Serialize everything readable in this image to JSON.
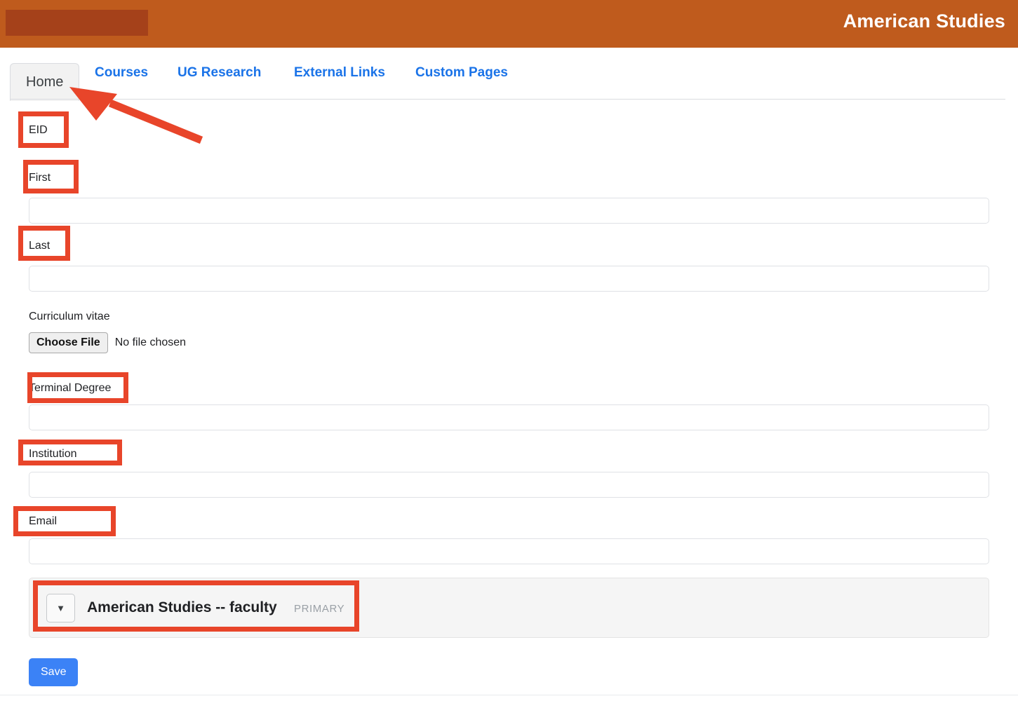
{
  "header": {
    "title": "American Studies",
    "logo_placeholder": "",
    "background_color": "#bf5b1d",
    "logo_block_color": "#a5411a"
  },
  "tabs": [
    {
      "label": "Home",
      "active": true
    },
    {
      "label": "Courses",
      "active": false
    },
    {
      "label": "UG Research",
      "active": false
    },
    {
      "label": "External Links",
      "active": false
    },
    {
      "label": "Custom Pages",
      "active": false
    }
  ],
  "form": {
    "fields": [
      {
        "label": "EID",
        "value": "",
        "has_input": false
      },
      {
        "label": "First",
        "value": "",
        "has_input": true
      },
      {
        "label": "Last",
        "value": "",
        "has_input": true
      },
      {
        "label": "Terminal Degree",
        "value": "",
        "has_input": true
      },
      {
        "label": "Institution",
        "value": "",
        "has_input": true
      },
      {
        "label": "Email",
        "value": "",
        "has_input": true
      }
    ],
    "cv": {
      "label": "Curriculum vitae",
      "button_label": "Choose File",
      "status_text": "No file chosen"
    },
    "accordion": {
      "toggle_icon": "caret-down-icon",
      "toggle_glyph": "▼",
      "title": "American Studies -- faculty",
      "badge": "PRIMARY"
    },
    "save_label": "Save",
    "save_color": "#3b82f6"
  },
  "annotations": {
    "highlight_color": "#e8452a",
    "arrow_target": "Home"
  }
}
